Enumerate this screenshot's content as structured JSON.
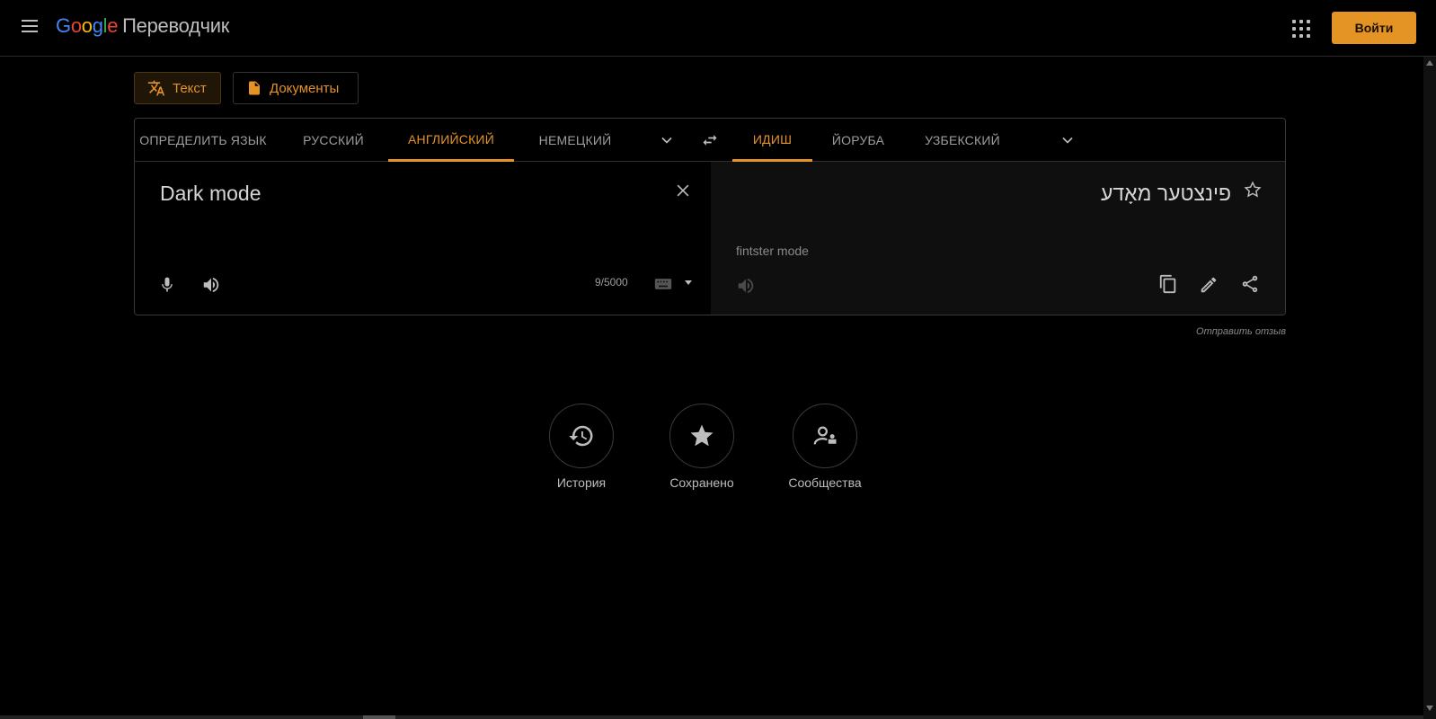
{
  "header": {
    "logo_google": [
      "G",
      "o",
      "o",
      "g",
      "l",
      "e"
    ],
    "product_name": "Переводчик",
    "signin_label": "Войти",
    "icons": [
      "menu-icon",
      "apps-grid-icon"
    ]
  },
  "modes": {
    "text_label": "Текст",
    "documents_label": "Документы"
  },
  "source_langs": {
    "detect": "ОПРЕДЕЛИТЬ ЯЗЫК",
    "tab1": "РУССКИЙ",
    "tab2": "АНГЛИЙСКИЙ",
    "tab3": "НЕМЕЦКИЙ",
    "active": "АНГЛИЙСКИЙ"
  },
  "target_langs": {
    "tab1": "ИДИШ",
    "tab2": "ЙОРУБА",
    "tab3": "УЗБЕКСКИЙ",
    "active": "ИДИШ"
  },
  "source": {
    "text": "Dark mode",
    "counter": "9/5000"
  },
  "target": {
    "text": "פינצטער מאָדע",
    "transliteration": "fintster mode"
  },
  "feedback_label": "Отправить отзыв",
  "shortcuts": {
    "history": "История",
    "saved": "Сохранено",
    "community": "Сообщества"
  },
  "colors": {
    "accent": "#e49325",
    "background": "#000000",
    "text": "#bdbdbd"
  }
}
